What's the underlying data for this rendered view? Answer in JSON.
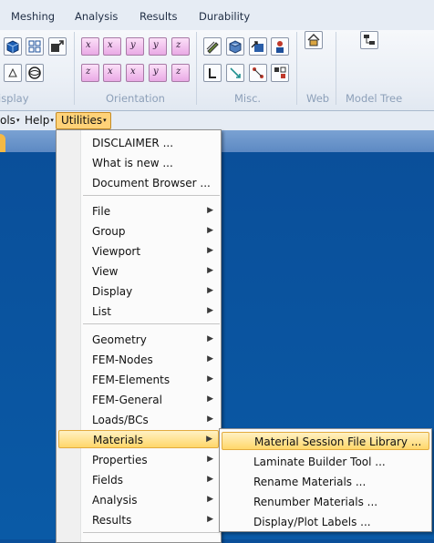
{
  "ribbon": {
    "tabs": [
      "Meshing",
      "Analysis",
      "Results",
      "Durability"
    ],
    "groups": {
      "display": "isplay",
      "orientation": "Orientation",
      "misc": "Misc.",
      "web": "Web",
      "model_tree": "Model Tree"
    },
    "orientation_buttons": [
      "x",
      "x",
      "y",
      "y",
      "z",
      "z",
      "x",
      "x",
      "y",
      "y",
      "z",
      "z"
    ]
  },
  "menubar": {
    "tools": "ols",
    "help": "Help",
    "utilities": "Utilities",
    "caret": "▾"
  },
  "utilities_menu": {
    "items": [
      {
        "label": "DISCLAIMER ...",
        "submenu": false
      },
      {
        "label": "What is new ...",
        "submenu": false
      },
      {
        "label": "Document Browser ...",
        "submenu": false
      },
      {
        "label": "File",
        "submenu": true
      },
      {
        "label": "Group",
        "submenu": true
      },
      {
        "label": "Viewport",
        "submenu": true
      },
      {
        "label": "View",
        "submenu": true
      },
      {
        "label": "Display",
        "submenu": true
      },
      {
        "label": "List",
        "submenu": true
      },
      {
        "label": "Geometry",
        "submenu": true
      },
      {
        "label": "FEM-Nodes",
        "submenu": true
      },
      {
        "label": "FEM-Elements",
        "submenu": true
      },
      {
        "label": "FEM-General",
        "submenu": true
      },
      {
        "label": "Loads/BCs",
        "submenu": true
      },
      {
        "label": "Materials",
        "submenu": true,
        "highlighted": true
      },
      {
        "label": "Properties",
        "submenu": true
      },
      {
        "label": "Fields",
        "submenu": true
      },
      {
        "label": "Analysis",
        "submenu": true
      },
      {
        "label": "Results",
        "submenu": true
      }
    ],
    "arrow": "▶"
  },
  "materials_submenu": {
    "items": [
      {
        "label": "Material Session File Library ...",
        "highlighted": true
      },
      {
        "label": "Laminate Builder Tool ..."
      },
      {
        "label": "Rename Materials ..."
      },
      {
        "label": "Renumber Materials ..."
      },
      {
        "label": "Display/Plot Labels ..."
      }
    ]
  },
  "colors": {
    "viewport_bg": "#0a4f9a",
    "highlight": "#ffd76a",
    "orientation_button": "#e9a9e5"
  },
  "icons": {
    "display": [
      "cube-icon",
      "grid-icon",
      "arrow-box-icon",
      "triangle-icon",
      "sphere-wire-icon"
    ],
    "misc": [
      "pencil-icon",
      "shaded-cube-icon",
      "arrow-cube-icon",
      "person-icon",
      "bracket-icon",
      "diagonal-arrow-icon",
      "nodes-icon",
      "matrix-icon"
    ],
    "web": "home-icon",
    "model_tree": "tree-icon"
  }
}
